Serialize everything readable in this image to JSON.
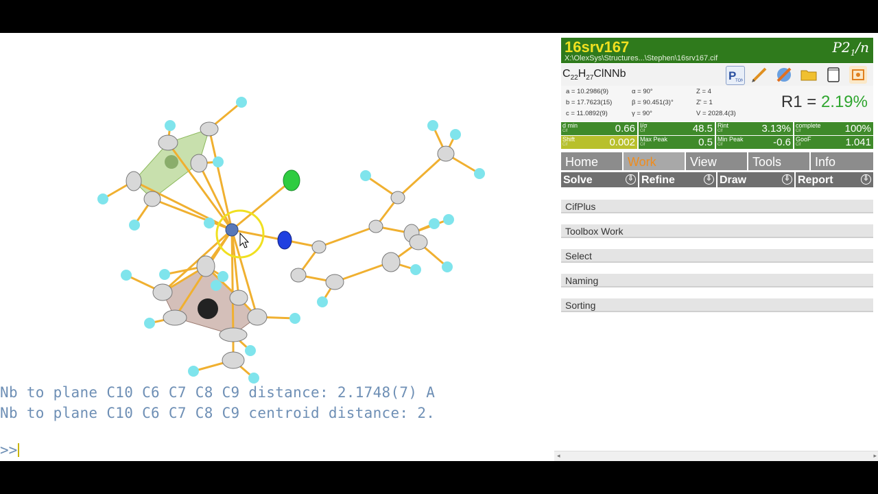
{
  "console": {
    "line1": "Nb to plane C10 C6 C7 C8 C9 distance: 2.1748(7) A",
    "line2": "Nb to plane C10 C6 C7 C8 C9 centroid distance: 2.",
    "prompt": ">>"
  },
  "header": {
    "file_name": "16srv167",
    "file_path": "X:\\OlexSys\\Structures...\\Stephen\\16srv167.cif",
    "space_group": "P2",
    "space_group_sub": "1",
    "space_group_tail": "/n"
  },
  "formula": {
    "c": "C",
    "c_n": "22",
    "h": "H",
    "h_n": "27",
    "rest": "ClNNb"
  },
  "toolbar_icons": [
    "piton-icon",
    "pencil-icon",
    "wrench-icon",
    "folder-icon",
    "notepad-icon",
    "screenshot-icon"
  ],
  "cell": {
    "a": "a = 10.2986(9)",
    "b": "b = 17.7623(15)",
    "c": "c = 11.0892(9)",
    "alpha": "α = 90°",
    "beta": "β = 90.451(3)°",
    "gamma": "γ = 90°",
    "Z": "Z = 4",
    "Zp": "Z' = 1",
    "V": "V = 2028.4(3)"
  },
  "r1": {
    "label": "R1 =",
    "value": "2.19%"
  },
  "stats_row1": [
    {
      "label": "d min",
      "sub": "Cif",
      "value": "0.66"
    },
    {
      "label": "I/σ",
      "sub": "Cif",
      "value": "48.5"
    },
    {
      "label": "Rint",
      "sub": "Cif",
      "value": "3.13%"
    },
    {
      "label": "complete",
      "sub": "Cif",
      "value": "100%"
    }
  ],
  "stats_row2": [
    {
      "label": "Shift",
      "sub": "Cif",
      "value": "0.002"
    },
    {
      "label": "Max Peak",
      "sub": "Cif",
      "value": "0.5"
    },
    {
      "label": "Min Peak",
      "sub": "Cif",
      "value": "-0.6"
    },
    {
      "label": "GooF",
      "sub": "Cif",
      "value": "1.041"
    }
  ],
  "tabs": [
    "Home",
    "Work",
    "View",
    "Tools",
    "Info"
  ],
  "active_tab": "Work",
  "subtabs": [
    "Solve",
    "Refine",
    "Draw",
    "Report"
  ],
  "subtab_arrow": "⇩",
  "sections": [
    "CifPlus",
    "Toolbox Work",
    "Select",
    "Naming",
    "Sorting"
  ],
  "scroll": {
    "left": "◂",
    "right": "▸"
  },
  "colors": {
    "header_green": "#2f7a1c",
    "stat_green": "#3f8a2a",
    "warn_yellow": "#b8c02c",
    "active_tab_orange": "#f08c1c",
    "console_text": "#6e8fb5",
    "bond": "#f0b030"
  }
}
